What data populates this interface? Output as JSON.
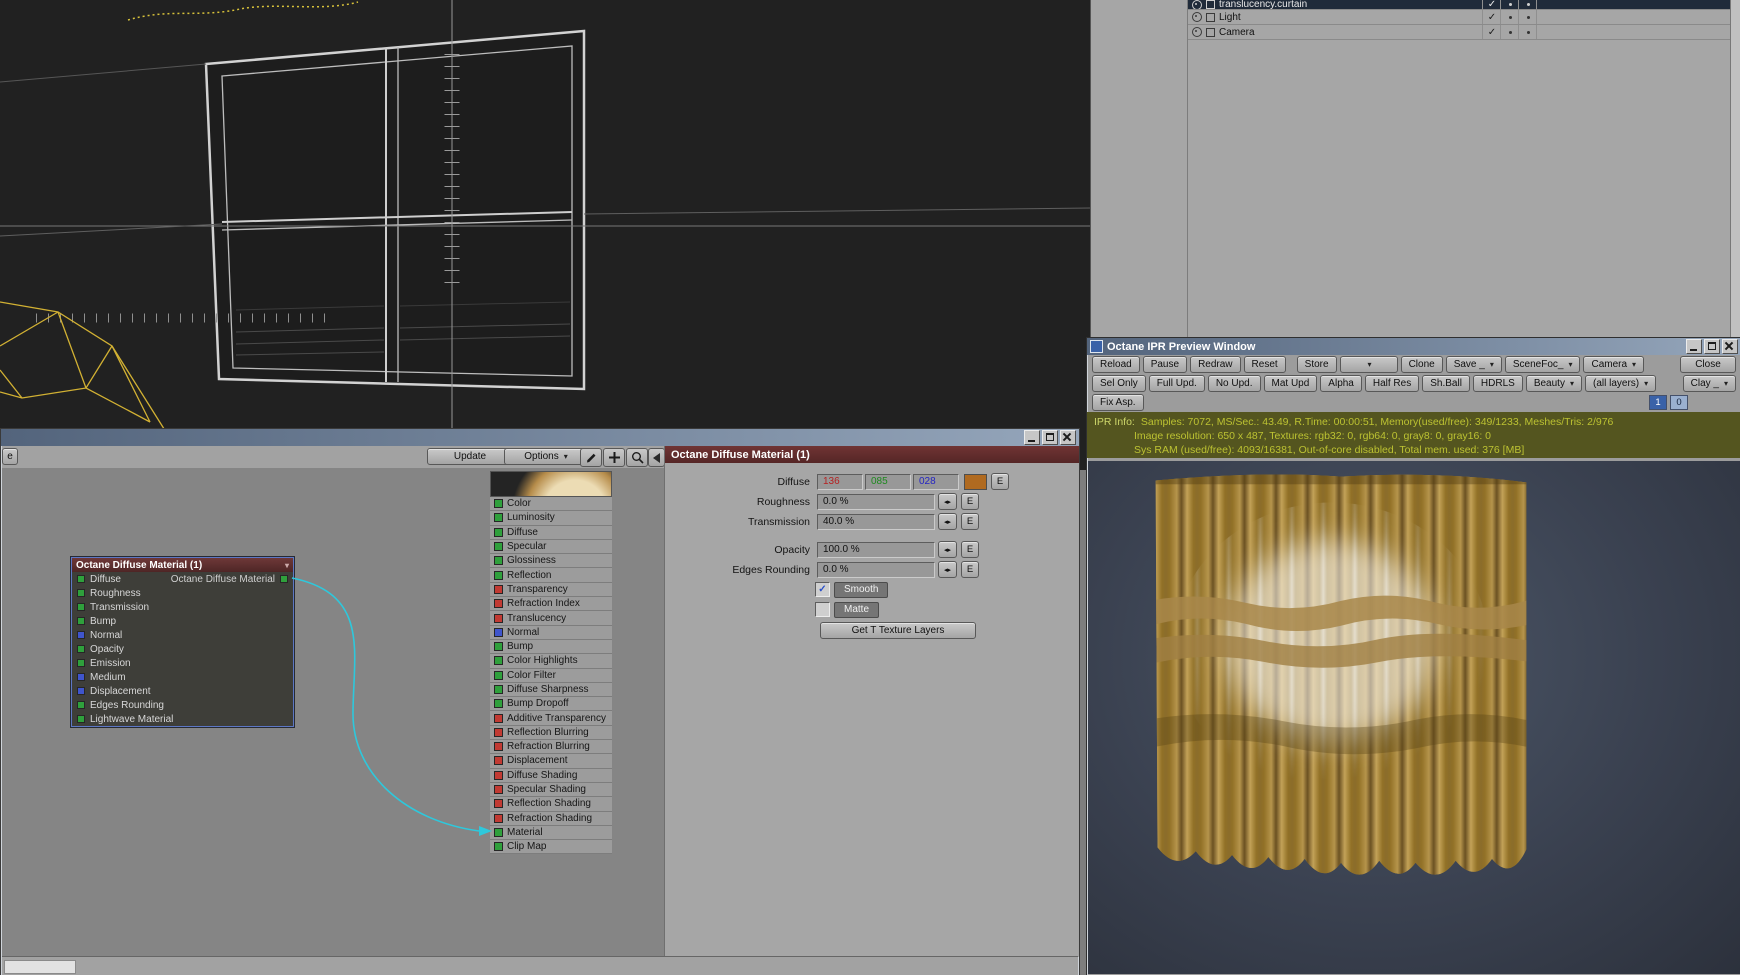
{
  "scene_panel": {
    "rows": [
      {
        "label": "translucency.curtain",
        "checked": true
      },
      {
        "label": "Light",
        "checked": true
      },
      {
        "label": "Camera",
        "checked": true
      }
    ]
  },
  "node_editor": {
    "toolbar": {
      "partial_left": "e",
      "update": "Update",
      "options": "Options"
    },
    "node": {
      "title": "Octane Diffuse Material (1)",
      "output_label": "Octane Diffuse Material",
      "inputs": [
        {
          "label": "Diffuse",
          "color": "green"
        },
        {
          "label": "Roughness",
          "color": "green"
        },
        {
          "label": "Transmission",
          "color": "green"
        },
        {
          "label": "Bump",
          "color": "green"
        },
        {
          "label": "Normal",
          "color": "blue"
        },
        {
          "label": "Opacity",
          "color": "green"
        },
        {
          "label": "Emission",
          "color": "green"
        },
        {
          "label": "Medium",
          "color": "blue"
        },
        {
          "label": "Displacement",
          "color": "blue"
        },
        {
          "label": "Edges Rounding",
          "color": "green"
        },
        {
          "label": "Lightwave Material",
          "color": "green"
        }
      ],
      "output_color": "green"
    },
    "channels": [
      {
        "label": "Color",
        "color": "green"
      },
      {
        "label": "Luminosity",
        "color": "green"
      },
      {
        "label": "Diffuse",
        "color": "green"
      },
      {
        "label": "Specular",
        "color": "green"
      },
      {
        "label": "Glossiness",
        "color": "green"
      },
      {
        "label": "Reflection",
        "color": "green"
      },
      {
        "label": "Transparency",
        "color": "red"
      },
      {
        "label": "Refraction Index",
        "color": "red"
      },
      {
        "label": "Translucency",
        "color": "red"
      },
      {
        "label": "Normal",
        "color": "blue"
      },
      {
        "label": "Bump",
        "color": "green"
      },
      {
        "label": "Color Highlights",
        "color": "green"
      },
      {
        "label": "Color Filter",
        "color": "green"
      },
      {
        "label": "Diffuse Sharpness",
        "color": "green"
      },
      {
        "label": "Bump Dropoff",
        "color": "green"
      },
      {
        "label": "Additive Transparency",
        "color": "red"
      },
      {
        "label": "Reflection Blurring",
        "color": "red"
      },
      {
        "label": "Refraction Blurring",
        "color": "red"
      },
      {
        "label": "Displacement",
        "color": "red"
      },
      {
        "label": "Diffuse Shading",
        "color": "red"
      },
      {
        "label": "Specular Shading",
        "color": "red"
      },
      {
        "label": "Reflection Shading",
        "color": "red"
      },
      {
        "label": "Refraction Shading",
        "color": "red"
      },
      {
        "label": "Material",
        "color": "green"
      },
      {
        "label": "Clip Map",
        "color": "green"
      }
    ]
  },
  "properties": {
    "title": "Octane Diffuse Material (1)",
    "env_button": "E",
    "rows": {
      "diffuse": {
        "label": "Diffuse",
        "r": "136",
        "g": "085",
        "b": "028",
        "swatch": "#b06a20"
      },
      "roughness": {
        "label": "Roughness",
        "value": "0.0 %"
      },
      "transmission": {
        "label": "Transmission",
        "value": "40.0 %"
      },
      "opacity": {
        "label": "Opacity",
        "value": "100.0 %"
      },
      "edges_rounding": {
        "label": "Edges Rounding",
        "value": "0.0 %"
      }
    },
    "smooth_label": "Smooth",
    "smooth_checked": true,
    "matte_label": "Matte",
    "matte_checked": false,
    "get_t_button": "Get T Texture Layers"
  },
  "ipr": {
    "title": "Octane IPR Preview Window",
    "toolbar1": [
      "Reload",
      "Pause",
      "Redraw",
      "Reset",
      "Store",
      "",
      "Clone",
      "Save _",
      "SceneFoc_",
      "Camera",
      "Close"
    ],
    "toolbar2": [
      "Sel Only",
      "Full Upd.",
      "No Upd.",
      "Mat Upd",
      "Alpha",
      "Half Res",
      "Sh.Ball",
      "HDRLS",
      "Beauty",
      "(all layers)",
      "Clay _"
    ],
    "fix_asp": "Fix Asp.",
    "counter_left": "1",
    "counter_right": "0",
    "info_label": "IPR Info:",
    "info_lines": [
      "Samples: 7072, MS/Sec.: 43.49, R.Time: 00:00:51, Memory(used/free): 349/1233, Meshes/Tris: 2/976",
      "Image resolution: 650 x 487, Textures:  rgb32: 0, rgb64: 0, gray8: 0, gray16: 0",
      "Sys RAM (used/free): 4093/16381, Out-of-core disabled, Total mem. used: 376  [MB]"
    ]
  },
  "colors": {
    "wire": "#2ec8dc",
    "node_header": "#5d2c2c",
    "panel_header": "#6a3030",
    "info_bg": "#54551f",
    "info_text": "#bcc232"
  }
}
